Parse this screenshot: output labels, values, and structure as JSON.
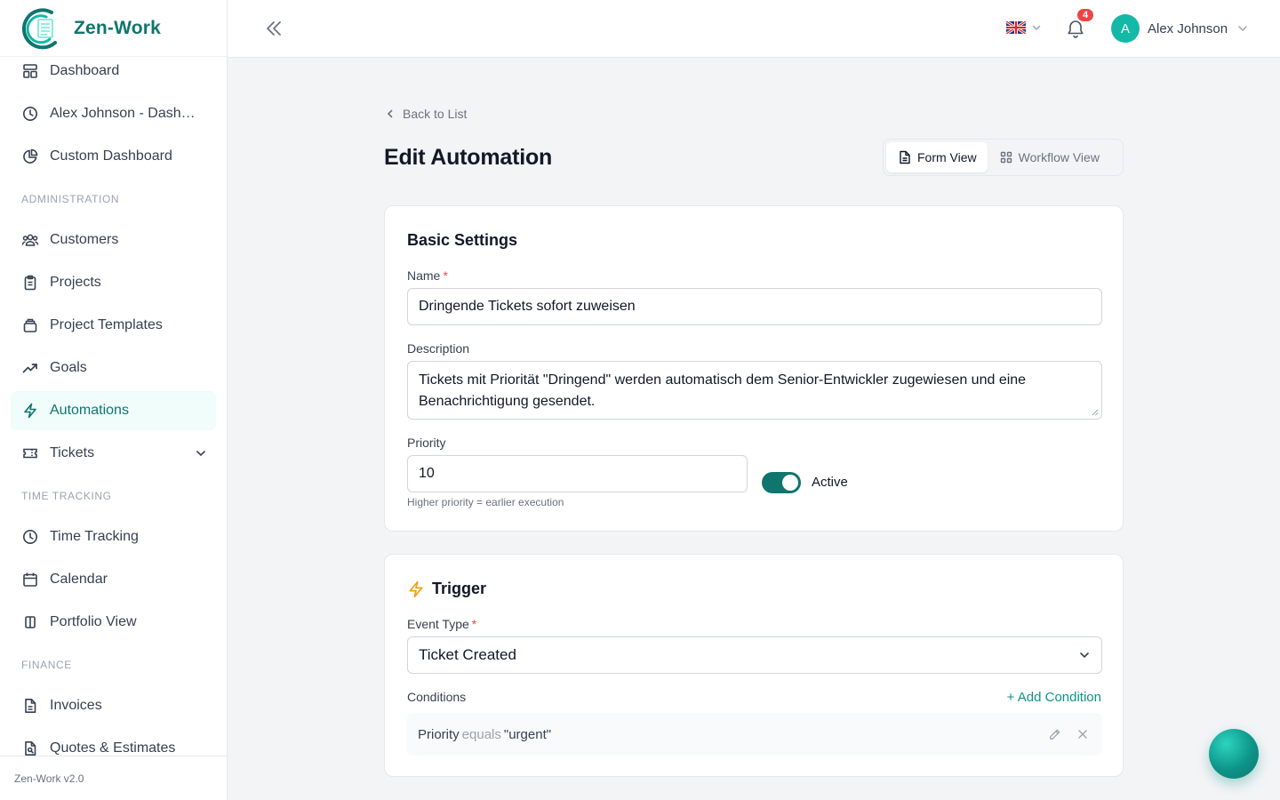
{
  "brand": {
    "name": "Zen-Work",
    "version": "Zen-Work v2.0"
  },
  "colors": {
    "accent": "#0f766e",
    "accent_light": "#14b8a6",
    "danger": "#ef4444"
  },
  "sidebar": {
    "items": [
      {
        "label": "Dashboard",
        "icon": "dashboard-icon"
      },
      {
        "label": "Alex Johnson - Dashboard",
        "icon": "clock-icon"
      },
      {
        "label": "Custom Dashboard",
        "icon": "pie-chart-icon"
      }
    ],
    "sections": [
      {
        "title": "ADMINISTRATION",
        "items": [
          {
            "label": "Customers",
            "icon": "users-icon"
          },
          {
            "label": "Projects",
            "icon": "clipboard-icon"
          },
          {
            "label": "Project Templates",
            "icon": "template-icon"
          },
          {
            "label": "Goals",
            "icon": "trend-up-icon"
          },
          {
            "label": "Automations",
            "icon": "lightning-icon",
            "active": true
          },
          {
            "label": "Tickets",
            "icon": "ticket-icon",
            "expandable": true
          }
        ]
      },
      {
        "title": "TIME TRACKING",
        "items": [
          {
            "label": "Time Tracking",
            "icon": "clock-icon"
          },
          {
            "label": "Calendar",
            "icon": "calendar-icon"
          },
          {
            "label": "Portfolio View",
            "icon": "columns-icon"
          }
        ]
      },
      {
        "title": "FINANCE",
        "items": [
          {
            "label": "Invoices",
            "icon": "document-icon"
          },
          {
            "label": "Quotes & Estimates",
            "icon": "document-search-icon"
          }
        ]
      }
    ]
  },
  "header": {
    "notifications_count": "4",
    "language_icon": "uk-flag-icon",
    "user": {
      "initial": "A",
      "name": "Alex Johnson"
    }
  },
  "page": {
    "back_label": "Back to List",
    "title": "Edit Automation",
    "views": {
      "form": "Form View",
      "workflow": "Workflow View"
    }
  },
  "basic_settings": {
    "title": "Basic Settings",
    "name_label": "Name",
    "name_value": "Dringende Tickets sofort zuweisen",
    "description_label": "Description",
    "description_value": "Tickets mit Priorität \"Dringend\" werden automatisch dem Senior-Entwickler zugewiesen und eine Benachrichtigung gesendet.",
    "priority_label": "Priority",
    "priority_value": "10",
    "priority_hint": "Higher priority = earlier execution",
    "active_label": "Active",
    "active": true
  },
  "trigger": {
    "title": "Trigger",
    "event_type_label": "Event Type",
    "event_type_value": "Ticket Created",
    "conditions_label": "Conditions",
    "add_condition_label": "+ Add Condition",
    "conditions": [
      {
        "field": "Priority",
        "operator": "equals",
        "value": "\"urgent\""
      }
    ]
  }
}
